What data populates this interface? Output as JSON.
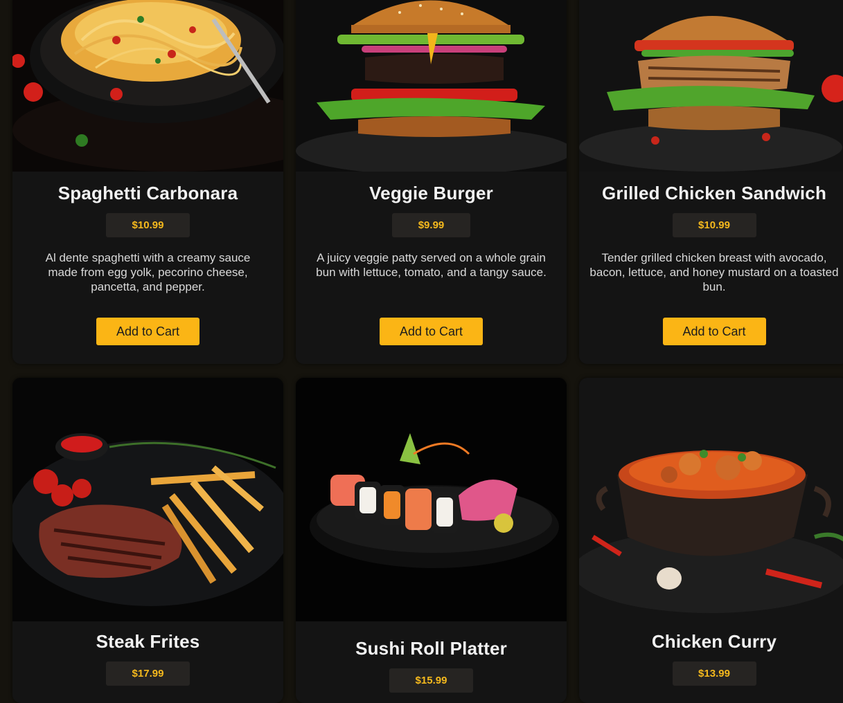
{
  "menu": {
    "items": [
      {
        "name": "Spaghetti Carbonara",
        "price": "$10.99",
        "description": "Al dente spaghetti with a creamy sauce made from egg yolk, pecorino cheese, pancetta, and pepper.",
        "button": "Add to Cart",
        "image": "spaghetti-plate"
      },
      {
        "name": "Veggie Burger",
        "price": "$9.99",
        "description": "A juicy veggie patty served on a whole grain bun with lettuce, tomato, and a tangy sauce.",
        "button": "Add to Cart",
        "image": "burger"
      },
      {
        "name": "Grilled Chicken Sandwich",
        "price": "$10.99",
        "description": "Tender grilled chicken breast with avocado, bacon, lettuce, and honey mustard on a toasted bun.",
        "button": "Add to Cart",
        "image": "chicken-sandwich"
      },
      {
        "name": "Steak Frites",
        "price": "$17.99",
        "image": "steak-and-fries"
      },
      {
        "name": "Sushi Roll Platter",
        "price": "$15.99",
        "image": "sushi-platter"
      },
      {
        "name": "Chicken Curry",
        "price": "$13.99",
        "image": "curry-pot"
      }
    ]
  },
  "colors": {
    "accent": "#fbb515",
    "price_text": "#f5b91d",
    "card_bg": "#141414",
    "page_bg": "#15130d"
  }
}
